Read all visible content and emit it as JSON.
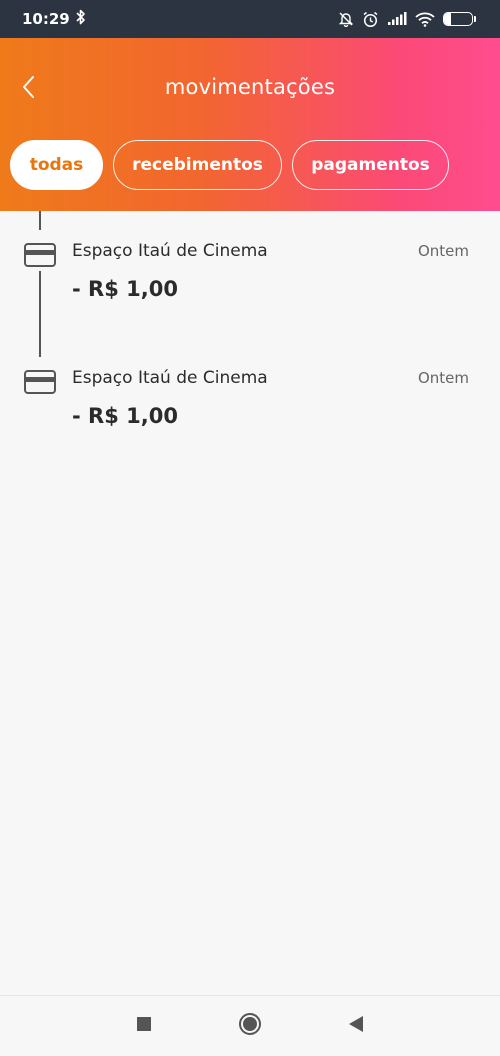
{
  "status_bar": {
    "time": "10:29",
    "battery_level": "25",
    "battery_fraction": 0.25,
    "icons": [
      "bluetooth-icon",
      "bell-off-icon",
      "alarm-icon",
      "signal-icon",
      "wifi-icon",
      "battery-icon"
    ]
  },
  "header": {
    "title": "movimentações",
    "back_icon": "chevron-left-icon",
    "gradient": [
      "#ef7a1a",
      "#ff4c8f"
    ]
  },
  "tabs": [
    {
      "label": "todas",
      "active": true
    },
    {
      "label": "recebimentos",
      "active": false
    },
    {
      "label": "pagamentos",
      "active": false
    }
  ],
  "transactions": [
    {
      "name": "Espaço Itaú de Cinema",
      "date": "Ontem",
      "amount": "- R$ 1,00",
      "icon": "credit-card-icon"
    },
    {
      "name": "Espaço Itaú de Cinema",
      "date": "Ontem",
      "amount": "- R$ 1,00",
      "icon": "credit-card-icon"
    }
  ],
  "nav_bar": {
    "icons": [
      "square-recents-icon",
      "circle-home-icon",
      "triangle-back-icon"
    ]
  },
  "colors": {
    "accent": "#e8750e",
    "status_bar": "#2b3440",
    "background": "#f7f7f7",
    "text": "#2b2b2b"
  }
}
